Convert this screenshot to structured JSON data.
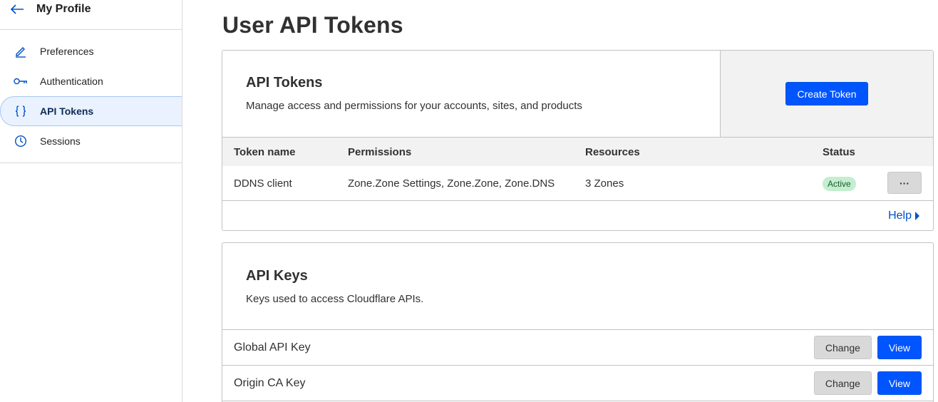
{
  "sidebar": {
    "title": "My Profile",
    "items": [
      {
        "label": "Preferences",
        "icon": "pencil-icon",
        "active": false
      },
      {
        "label": "Authentication",
        "icon": "key-icon",
        "active": false
      },
      {
        "label": "API Tokens",
        "icon": "braces-icon",
        "active": true
      },
      {
        "label": "Sessions",
        "icon": "clock-icon",
        "active": false
      }
    ]
  },
  "main": {
    "title": "User API Tokens",
    "tokens_card": {
      "heading": "API Tokens",
      "description": "Manage access and permissions for your accounts, sites, and products",
      "create_label": "Create Token",
      "columns": [
        "Token name",
        "Permissions",
        "Resources",
        "Status"
      ],
      "rows": [
        {
          "name": "DDNS client",
          "permissions": "Zone.Zone Settings, Zone.Zone, Zone.DNS",
          "resources": "3 Zones",
          "status": "Active",
          "more_label": "···"
        }
      ],
      "help_label": "Help"
    },
    "keys_card": {
      "heading": "API Keys",
      "description": "Keys used to access Cloudflare APIs.",
      "rows": [
        {
          "name": "Global API Key",
          "change_label": "Change",
          "view_label": "View"
        },
        {
          "name": "Origin CA Key",
          "change_label": "Change",
          "view_label": "View"
        }
      ]
    }
  },
  "colors": {
    "accent": "#0055ff",
    "link": "#0051c3",
    "active_bg": "#e9f2fe",
    "badge_bg": "#c3eecf"
  }
}
